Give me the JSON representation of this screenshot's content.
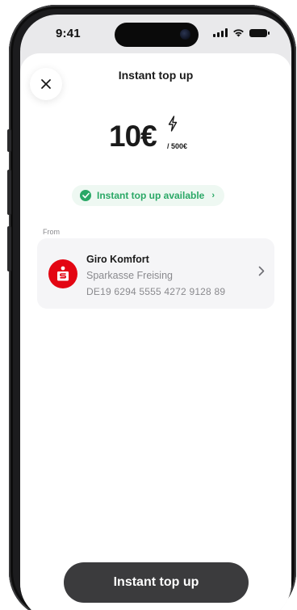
{
  "status_bar": {
    "time": "9:41"
  },
  "sheet": {
    "title": "Instant top up",
    "close_icon": "close-icon"
  },
  "amount": {
    "value": "10€",
    "limit": "/ 500€",
    "bolt_icon": "lightning-icon"
  },
  "availability": {
    "label": "Instant top up available",
    "color": "#2aa866"
  },
  "source": {
    "label": "From",
    "account_name": "Giro Komfort",
    "bank_name": "Sparkasse Freising",
    "iban": "DE19 6294 5555 4272 9128 89",
    "logo_color": "#e30613"
  },
  "cta": {
    "label": "Instant top up"
  }
}
